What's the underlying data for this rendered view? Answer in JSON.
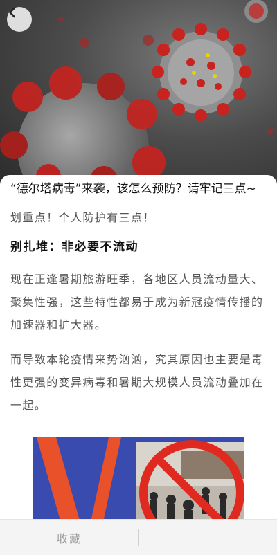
{
  "header": {
    "back_icon": "chevron-left-icon"
  },
  "hero": {
    "image": "coronavirus-illustration"
  },
  "article": {
    "title": "“德尔塔病毒”来袭，该怎么预防？请牢记三点~",
    "intro": "划重点！个人防护有三点！",
    "heading": "别扎堆：非必要不流动",
    "paragraphs": [
      "现在正逢暑期旅游旺季，各地区人员流动量大、聚集性强，这些特性都易于成为新冠疫情传播的加速器和扩大器。",
      "而导致本轮疫情来势汹汹，究其原因也主要是毒性更强的变异病毒和暑期大规模人员流动叠加在一起。"
    ],
    "image": "no-crowd-poster"
  },
  "bottom_bar": {
    "collect_label": "收藏"
  },
  "colors": {
    "virus_red": "#c8231f",
    "virus_grey": "#8f8f8f",
    "poster_blue": "#3a4bb0",
    "poster_orange": "#e8512a"
  }
}
